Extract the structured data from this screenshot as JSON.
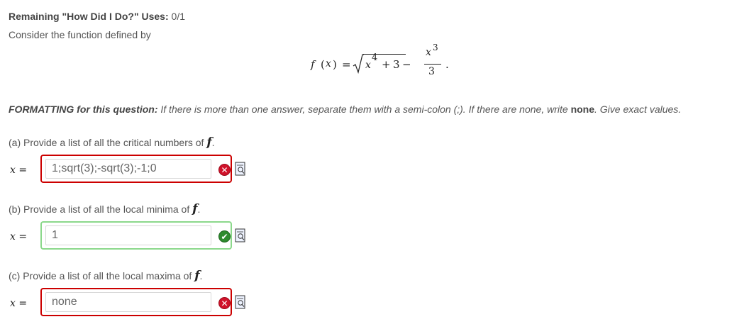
{
  "header": {
    "uses_label": "Remaining \"How Did I Do?\" Uses:",
    "uses_value": "0/1",
    "intro": "Consider the function defined by"
  },
  "formula": {
    "lhs": "f",
    "paren_open": "(",
    "var": "x",
    "paren_close": ")",
    "equals": "=",
    "sqrt_base": "x",
    "sqrt_exp": "4",
    "plus": "+",
    "const": "3",
    "minus": "−",
    "frac_num_base": "x",
    "frac_num_exp": "3",
    "frac_den": "3",
    "end": "."
  },
  "formatting": {
    "label": "FORMATTING for this question:",
    "text1": "If there is more than one answer, separate them with a semi-colon (;). If there are none, write",
    "none_word": "none",
    "text2": ". Give exact values."
  },
  "questions": [
    {
      "prompt": "(a) Provide a list of all the critical numbers of",
      "fn": "f",
      "tail": ".",
      "var_label": "x =",
      "answer": "1;sqrt(3);-sqrt(3);-1;0",
      "status": "incorrect",
      "status_icon": "x-icon",
      "status_color": "#d0122a"
    },
    {
      "prompt": "(b) Provide a list of all the local minima of",
      "fn": "f",
      "tail": ".",
      "var_label": "x =",
      "answer": "1",
      "status": "correct",
      "status_icon": "check-icon",
      "status_color": "#2e8b2e"
    },
    {
      "prompt": "(c) Provide a list of all the local maxima of",
      "fn": "f",
      "tail": ".",
      "var_label": "x =",
      "answer": "none",
      "status": "incorrect",
      "status_icon": "x-icon",
      "status_color": "#d0122a"
    }
  ],
  "icons": {
    "incorrect_glyph": "✕",
    "correct_glyph": "✔"
  }
}
